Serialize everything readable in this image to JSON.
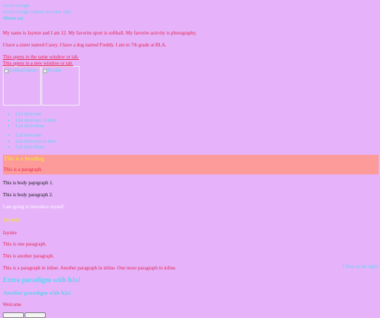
{
  "header": {
    "links": [
      "Go to Google",
      "Go to Google (opens in a new tab)"
    ],
    "title": "About me"
  },
  "intro": {
    "p1": "My name is Jaymie and I am 12. My favorite sport is softball. My favorite activity is photography.",
    "p2": "I have a sister named Casey. I have a dog named Freddy. I am in 7th grade at BLA."
  },
  "window_links": {
    "same": "This opens in the same window or tab.",
    "new": "This opens in a new window or tab."
  },
  "gallery": {
    "images": [
      {
        "alt": "Softball photo"
      },
      {
        "alt": "Freddy"
      }
    ]
  },
  "lists": {
    "first": [
      "List item one",
      "List item two is here",
      "List item three"
    ],
    "second": [
      "List item one",
      "List item two is here",
      "List item three"
    ]
  },
  "banner": {
    "heading": "This is a heading",
    "paragraph": "This is a paragraph."
  },
  "body": {
    "p1": "This is body paprgraph 1.",
    "p2": "This is body paragraph 2.",
    "intro_self": "I am going to introduce myself.",
    "name_heading": "Jaymie",
    "name_plain": "Jaymie",
    "one": "This is one paragraph.",
    "another": "This is another paragraph.",
    "inline": "This is a paragraph in inline. Another paragraph in inline. One more paragraph in inline.",
    "float_right": "I float to the right.",
    "big_heading": "Extra paradigm with h1s!",
    "medium_heading": "Another paradigm with h2s!",
    "welcome": "Welcome"
  },
  "buttons": [
    "",
    ""
  ]
}
